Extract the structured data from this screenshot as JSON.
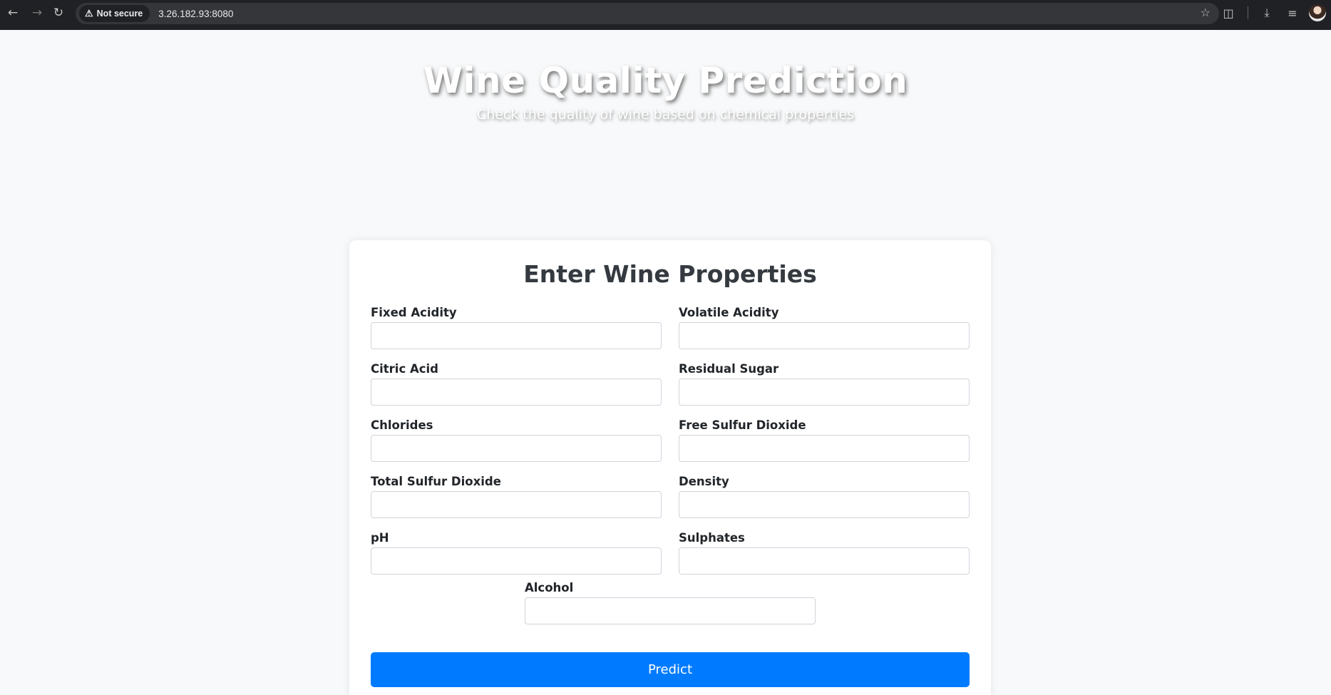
{
  "browser": {
    "security_label": "Not secure",
    "url": "3.26.182.93:8080"
  },
  "header": {
    "title": "Wine Quality Prediction",
    "subtitle": "Check the quality of wine based on chemical properties"
  },
  "form": {
    "title": "Enter Wine Properties",
    "fields": [
      {
        "label": "Fixed Acidity",
        "value": "",
        "placeholder": ""
      },
      {
        "label": "Volatile Acidity",
        "value": "",
        "placeholder": ""
      },
      {
        "label": "Citric Acid",
        "value": "",
        "placeholder": ""
      },
      {
        "label": "Residual Sugar",
        "value": "",
        "placeholder": ""
      },
      {
        "label": "Chlorides",
        "value": "",
        "placeholder": ""
      },
      {
        "label": "Free Sulfur Dioxide",
        "value": "",
        "placeholder": ""
      },
      {
        "label": "Total Sulfur Dioxide",
        "value": "",
        "placeholder": ""
      },
      {
        "label": "Density",
        "value": "",
        "placeholder": ""
      },
      {
        "label": "pH",
        "value": "",
        "placeholder": ""
      },
      {
        "label": "Sulphates",
        "value": "",
        "placeholder": ""
      },
      {
        "label": "Alcohol",
        "value": "",
        "placeholder": ""
      }
    ],
    "submit_label": "Predict"
  },
  "colors": {
    "primary_button": "#007bff",
    "page_background": "#f8f9fa",
    "chrome_background": "#202124"
  }
}
